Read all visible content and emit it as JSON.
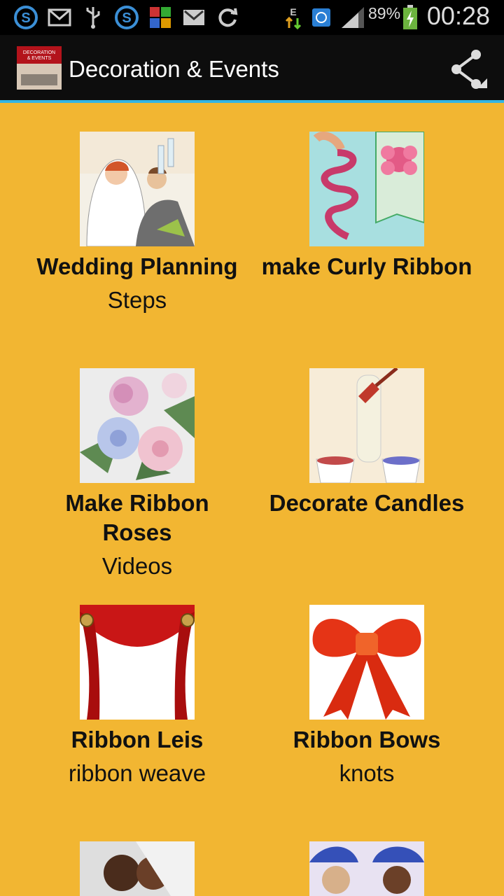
{
  "status_bar": {
    "battery": "89%",
    "time": "00:28",
    "network_letter": "E",
    "icons": [
      "skype-icon",
      "mail-icon",
      "usb-icon",
      "skype-icon",
      "app-icon",
      "gmail-icon",
      "sync-icon",
      "data-arrows-icon",
      "browser-icon",
      "signal-icon",
      "battery-icon"
    ]
  },
  "action_bar": {
    "title": "Decoration & Events",
    "app_icon_caption": "DECORATION & EVENTS",
    "share_icon": "share-icon"
  },
  "grid": [
    {
      "title": "Wedding Planning",
      "subtitle": "Steps"
    },
    {
      "title": "make Curly Ribbon",
      "subtitle": ""
    },
    {
      "title": "Make Ribbon Roses",
      "title_line1": "Make Ribbon",
      "title_line2": "Roses",
      "subtitle": "Videos"
    },
    {
      "title": "Decorate Candles",
      "subtitle": ""
    },
    {
      "title": "Ribbon Leis",
      "subtitle": "ribbon weave"
    },
    {
      "title": "Ribbon Bows",
      "subtitle": "knots"
    }
  ],
  "colors": {
    "background": "#f2b632",
    "action_bar": "#0d0d0d",
    "accent_line": "#33b5e5",
    "text": "#111111"
  }
}
